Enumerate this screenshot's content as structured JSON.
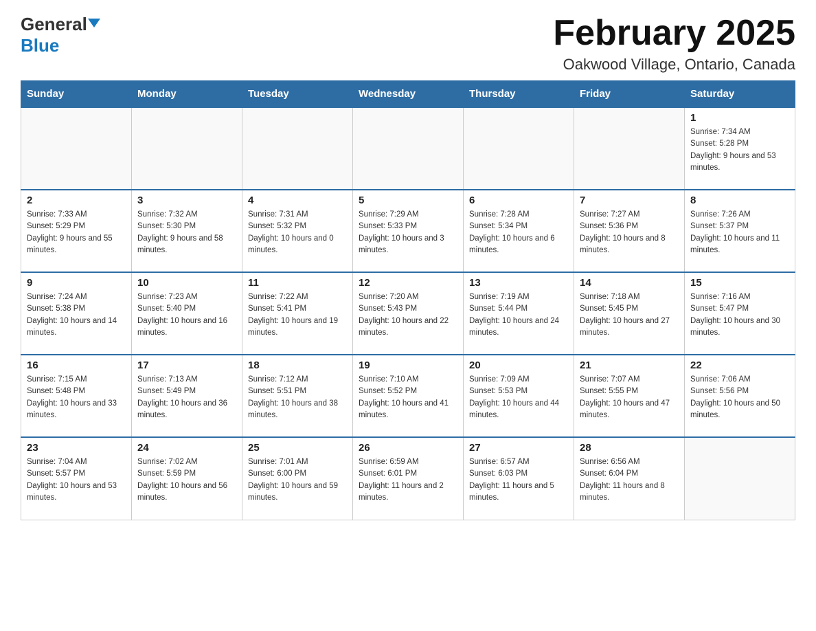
{
  "header": {
    "logo_general": "General",
    "logo_blue": "Blue",
    "month_title": "February 2025",
    "location": "Oakwood Village, Ontario, Canada"
  },
  "weekdays": [
    "Sunday",
    "Monday",
    "Tuesday",
    "Wednesday",
    "Thursday",
    "Friday",
    "Saturday"
  ],
  "weeks": [
    {
      "days": [
        {
          "number": "",
          "info": ""
        },
        {
          "number": "",
          "info": ""
        },
        {
          "number": "",
          "info": ""
        },
        {
          "number": "",
          "info": ""
        },
        {
          "number": "",
          "info": ""
        },
        {
          "number": "",
          "info": ""
        },
        {
          "number": "1",
          "info": "Sunrise: 7:34 AM\nSunset: 5:28 PM\nDaylight: 9 hours and 53 minutes."
        }
      ]
    },
    {
      "days": [
        {
          "number": "2",
          "info": "Sunrise: 7:33 AM\nSunset: 5:29 PM\nDaylight: 9 hours and 55 minutes."
        },
        {
          "number": "3",
          "info": "Sunrise: 7:32 AM\nSunset: 5:30 PM\nDaylight: 9 hours and 58 minutes."
        },
        {
          "number": "4",
          "info": "Sunrise: 7:31 AM\nSunset: 5:32 PM\nDaylight: 10 hours and 0 minutes."
        },
        {
          "number": "5",
          "info": "Sunrise: 7:29 AM\nSunset: 5:33 PM\nDaylight: 10 hours and 3 minutes."
        },
        {
          "number": "6",
          "info": "Sunrise: 7:28 AM\nSunset: 5:34 PM\nDaylight: 10 hours and 6 minutes."
        },
        {
          "number": "7",
          "info": "Sunrise: 7:27 AM\nSunset: 5:36 PM\nDaylight: 10 hours and 8 minutes."
        },
        {
          "number": "8",
          "info": "Sunrise: 7:26 AM\nSunset: 5:37 PM\nDaylight: 10 hours and 11 minutes."
        }
      ]
    },
    {
      "days": [
        {
          "number": "9",
          "info": "Sunrise: 7:24 AM\nSunset: 5:38 PM\nDaylight: 10 hours and 14 minutes."
        },
        {
          "number": "10",
          "info": "Sunrise: 7:23 AM\nSunset: 5:40 PM\nDaylight: 10 hours and 16 minutes."
        },
        {
          "number": "11",
          "info": "Sunrise: 7:22 AM\nSunset: 5:41 PM\nDaylight: 10 hours and 19 minutes."
        },
        {
          "number": "12",
          "info": "Sunrise: 7:20 AM\nSunset: 5:43 PM\nDaylight: 10 hours and 22 minutes."
        },
        {
          "number": "13",
          "info": "Sunrise: 7:19 AM\nSunset: 5:44 PM\nDaylight: 10 hours and 24 minutes."
        },
        {
          "number": "14",
          "info": "Sunrise: 7:18 AM\nSunset: 5:45 PM\nDaylight: 10 hours and 27 minutes."
        },
        {
          "number": "15",
          "info": "Sunrise: 7:16 AM\nSunset: 5:47 PM\nDaylight: 10 hours and 30 minutes."
        }
      ]
    },
    {
      "days": [
        {
          "number": "16",
          "info": "Sunrise: 7:15 AM\nSunset: 5:48 PM\nDaylight: 10 hours and 33 minutes."
        },
        {
          "number": "17",
          "info": "Sunrise: 7:13 AM\nSunset: 5:49 PM\nDaylight: 10 hours and 36 minutes."
        },
        {
          "number": "18",
          "info": "Sunrise: 7:12 AM\nSunset: 5:51 PM\nDaylight: 10 hours and 38 minutes."
        },
        {
          "number": "19",
          "info": "Sunrise: 7:10 AM\nSunset: 5:52 PM\nDaylight: 10 hours and 41 minutes."
        },
        {
          "number": "20",
          "info": "Sunrise: 7:09 AM\nSunset: 5:53 PM\nDaylight: 10 hours and 44 minutes."
        },
        {
          "number": "21",
          "info": "Sunrise: 7:07 AM\nSunset: 5:55 PM\nDaylight: 10 hours and 47 minutes."
        },
        {
          "number": "22",
          "info": "Sunrise: 7:06 AM\nSunset: 5:56 PM\nDaylight: 10 hours and 50 minutes."
        }
      ]
    },
    {
      "days": [
        {
          "number": "23",
          "info": "Sunrise: 7:04 AM\nSunset: 5:57 PM\nDaylight: 10 hours and 53 minutes."
        },
        {
          "number": "24",
          "info": "Sunrise: 7:02 AM\nSunset: 5:59 PM\nDaylight: 10 hours and 56 minutes."
        },
        {
          "number": "25",
          "info": "Sunrise: 7:01 AM\nSunset: 6:00 PM\nDaylight: 10 hours and 59 minutes."
        },
        {
          "number": "26",
          "info": "Sunrise: 6:59 AM\nSunset: 6:01 PM\nDaylight: 11 hours and 2 minutes."
        },
        {
          "number": "27",
          "info": "Sunrise: 6:57 AM\nSunset: 6:03 PM\nDaylight: 11 hours and 5 minutes."
        },
        {
          "number": "28",
          "info": "Sunrise: 6:56 AM\nSunset: 6:04 PM\nDaylight: 11 hours and 8 minutes."
        },
        {
          "number": "",
          "info": ""
        }
      ]
    }
  ]
}
